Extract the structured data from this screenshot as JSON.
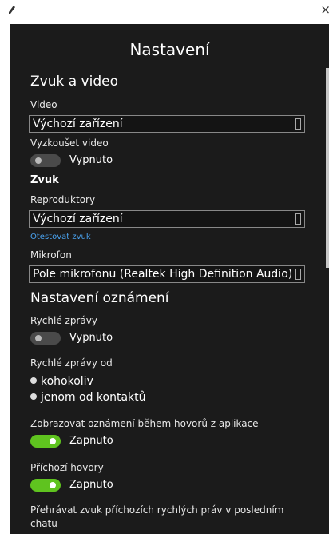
{
  "titlebar": {
    "close_glyph": "×"
  },
  "page": {
    "title": "Nastavení"
  },
  "sound_video": {
    "heading": "Zvuk a video",
    "video_label": "Video",
    "video_device": "Výchozí zařízení",
    "test_video_label": "Vyzkoušet video",
    "test_video_state": "Vypnuto",
    "sound_heading": "Zvuk",
    "speakers_label": "Reproduktory",
    "speakers_device": "Výchozí zařízení",
    "test_sound_link": "Otestovat zvuk",
    "mic_label": "Mikrofon",
    "mic_device": "Pole mikrofonu (Realtek High Definition Audio)"
  },
  "notifications": {
    "heading": "Nastavení oznámení",
    "quick_msgs_label": "Rychlé zprávy",
    "quick_msgs_state": "Vypnuto",
    "quick_from_label": "Rychlé zprávy od",
    "quick_from_options": [
      "kohokoliv",
      "jenom od kontaktů"
    ],
    "show_during_calls_label": "Zobrazovat oznámení během hovorů z aplikace",
    "show_during_calls_state": "Zapnuto",
    "incoming_calls_label": "Příchozí hovory",
    "incoming_calls_state": "Zapnuto",
    "play_sound_line1": "Přehrávat zvuk příchozích rychlých práv v posledním",
    "play_sound_line2": "chatu"
  },
  "colors": {
    "toggle_on": "#5fc31f",
    "toggle_off": "#4a4a4a",
    "link": "#4aa3f0",
    "background": "#1b1b1b"
  }
}
